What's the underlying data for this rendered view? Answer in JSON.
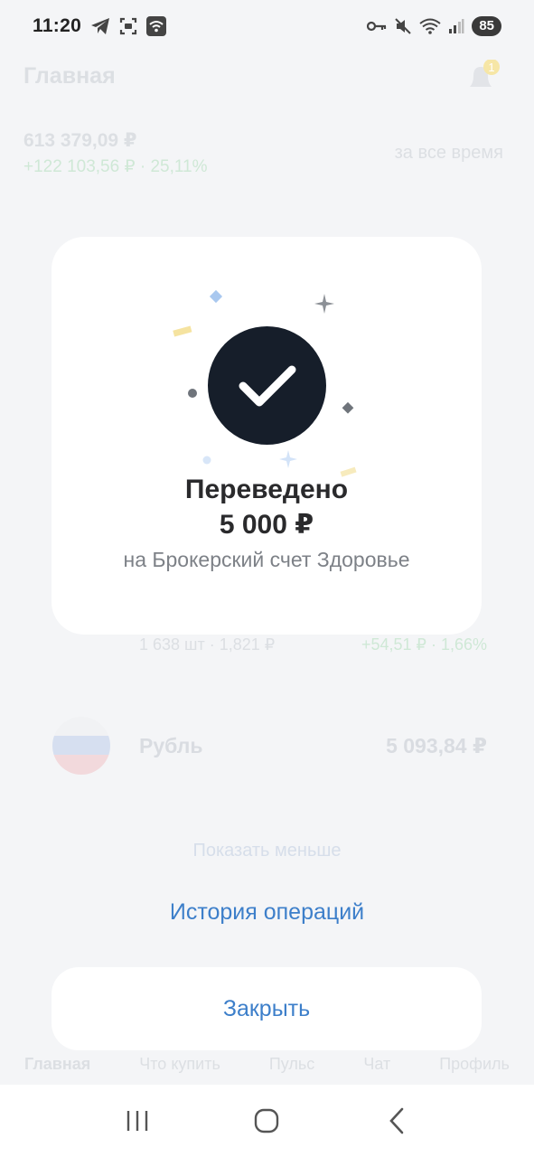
{
  "status_bar": {
    "time": "11:20",
    "battery": "85",
    "left_icons": [
      "telegram-icon",
      "screenshot-icon",
      "wifi-icon"
    ],
    "right_icons": [
      "key-icon",
      "mute-icon",
      "wifi-5-icon",
      "signal-icon"
    ]
  },
  "background": {
    "title": "Главная",
    "notification_count": "1",
    "balance": "613 379,09 ₽",
    "gain": "+122 103,56 ₽ · 25,11%",
    "period": "за все время",
    "asset_sub": "1 638 шт · 1,821 ₽",
    "asset_gain": "+54,51 ₽ · 1,66%",
    "ruble_name": "Рубль",
    "ruble_value": "5 093,84 ₽",
    "show_less": "Показать меньше",
    "nav": [
      "Главная",
      "Что купить",
      "Пульс",
      "Чат",
      "Профиль"
    ]
  },
  "modal": {
    "title": "Переведено",
    "amount": "5 000 ₽",
    "subtitle": "на Брокерский счет Здоровье"
  },
  "history_link": "История операций",
  "close_button": "Закрыть",
  "colors": {
    "accent": "#3d7fca",
    "check_bg": "#161e2a",
    "card_bg": "#ffffff",
    "overlay_bg": "#f4f5f7"
  }
}
